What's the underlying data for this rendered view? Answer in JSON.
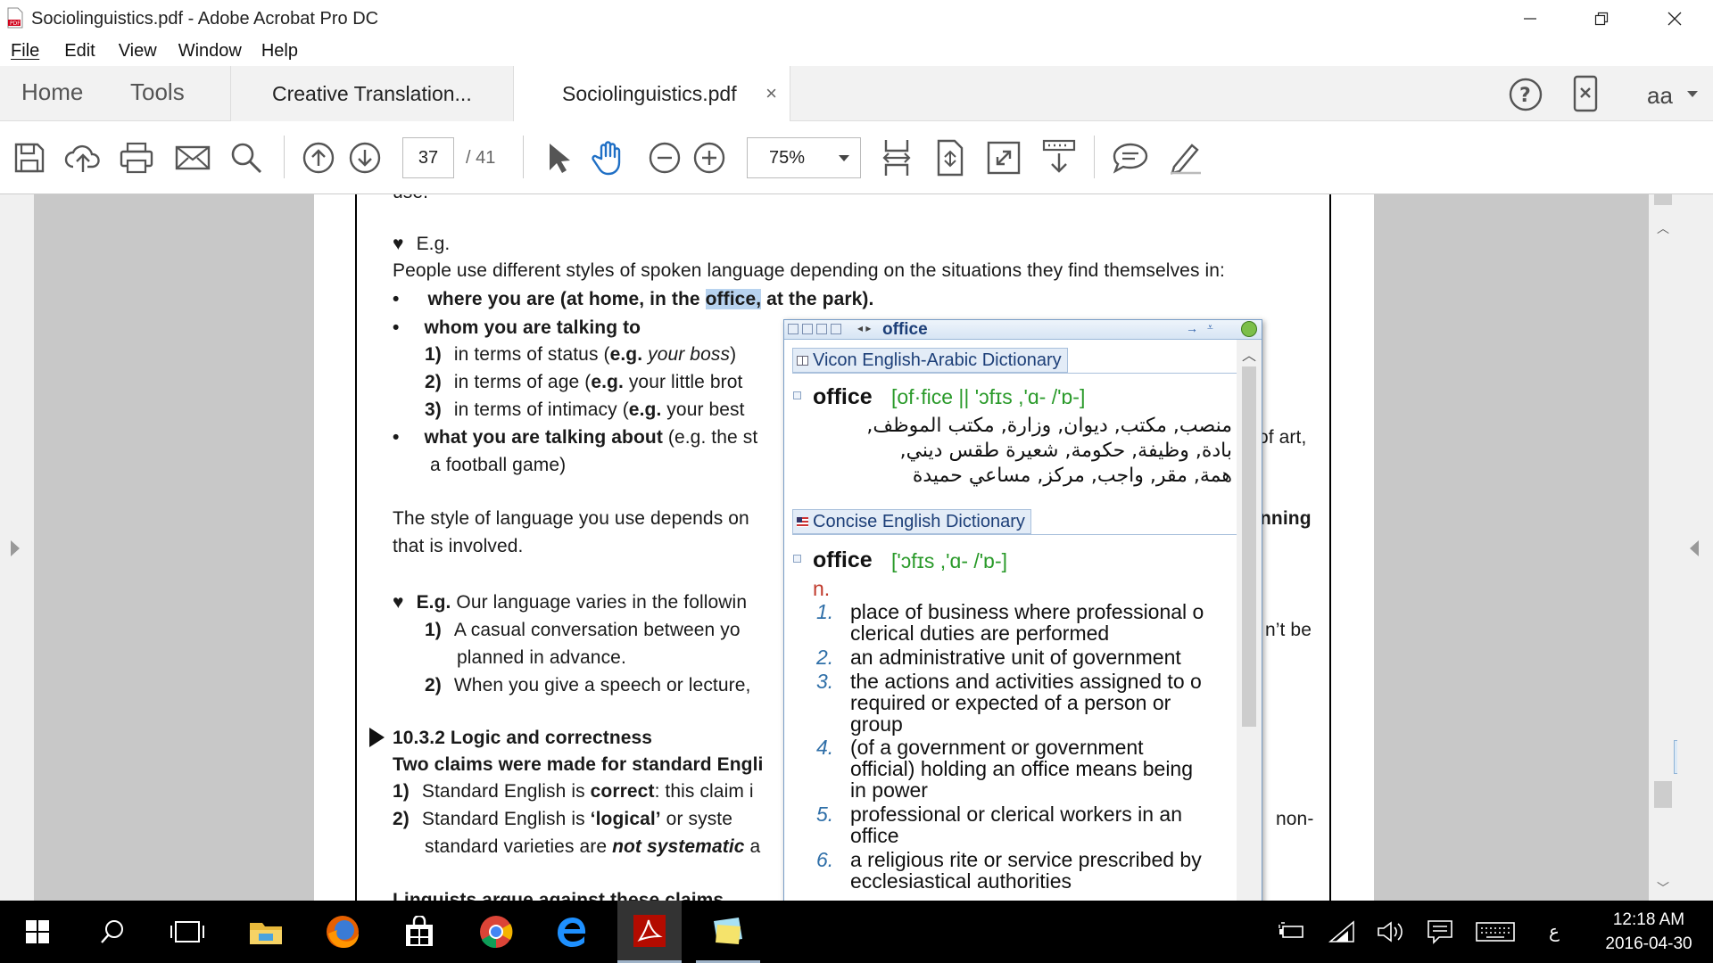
{
  "window": {
    "title": "Sociolinguistics.pdf - Adobe Acrobat Pro DC",
    "app_icon": "acrobat-pdf-icon",
    "controls": [
      "minimize-icon",
      "restore-icon",
      "close-icon"
    ]
  },
  "menu": [
    "File",
    "Edit",
    "View",
    "Window",
    "Help"
  ],
  "tabs": {
    "home": "Home",
    "tools": "Tools",
    "documents": [
      {
        "label": "Creative Translation...",
        "active": false
      },
      {
        "label": "Sociolinguistics.pdf",
        "active": true,
        "close": "×"
      }
    ],
    "right": {
      "help": "?",
      "font_size": "aa"
    }
  },
  "toolbar": {
    "page_current": "37",
    "page_total": "/  41",
    "zoom": "75%",
    "icons": [
      "save-icon",
      "cloud-upload-icon",
      "print-icon",
      "email-icon",
      "search-icon",
      "page-up-icon",
      "page-down-icon",
      "select-arrow-icon",
      "hand-tool-icon",
      "zoom-out-icon",
      "zoom-in-icon",
      "fit-page-icon",
      "scroll-mode-icon",
      "full-screen-icon",
      "read-mode-icon",
      "comment-icon",
      "sign-pen-icon"
    ]
  },
  "document": {
    "cutoff_top": "use.",
    "eg1_label": "E.g.",
    "intro": "People use different styles of spoken language  depending on the situations they find themselves in:",
    "bullet1_pre": "where you are (at home, in the ",
    "bullet1_hl": "office,",
    "bullet1_post": " at the park).",
    "bullet2": "whom you are talking to",
    "sub1_num": "1)",
    "sub1_pre": "in terms of status (",
    "sub1_eg": "e.g.",
    "sub1_it": " your boss",
    "sub1_post": ")",
    "sub2_num": "2)",
    "sub2_pre": "in terms of age (",
    "sub2_eg": "e.g.",
    "sub2_post": " your little brot",
    "sub3_num": "3)",
    "sub3_pre": "in terms of intimacy (",
    "sub3_eg": "e.g.",
    "sub3_post": " your best",
    "bullet3_b": "what you are talking about",
    "bullet3_post": " (e.g. the st",
    "bullet3_right": "of art,",
    "bullet3_cont": "a football game)",
    "style_pre": "The style of language you use depends on",
    "style_right": "nning",
    "style_cont": "that is involved.",
    "eg2_label": "E.g.",
    "eg2_text": " Our language varies in the followin",
    "eg2_1_num": "1)",
    "eg2_1_text": "A  casual  conversation  between  yo",
    "eg2_1_right": "n’t  be",
    "eg2_1_cont": "planned in advance.",
    "eg2_2_num": "2)",
    "eg2_2_text": "When you give a speech or lecture,",
    "section_title": "10.3.2 Logic and correctness",
    "claims": "Two claims were made for standard Engli",
    "claim1_num": "1)",
    "claim1_pre": "Standard English is ",
    "claim1_b": "correct",
    "claim1_post": ": this claim i",
    "claim2_num": "2)",
    "claim2_pre": "Standard  English  is  ",
    "claim2_b": "‘logical’",
    "claim2_post": "  or  syste",
    "claim2_right": "non-",
    "claim2_cont_pre": "standard varieties are ",
    "claim2_cont_bi": "not systematic",
    "claim2_cont_post": " a",
    "cutoff_bottom": "Linguists argue against these claims"
  },
  "dictionary_popup": {
    "lookup_word": "office",
    "sections": [
      {
        "name": "Vicon English-Arabic Dictionary",
        "headword": "office",
        "pronunciation": "[of·fice || 'ɔfɪs ,'ɑ- /'ɒ-]",
        "arabic_lines": [
          "منصب, مكتب, ديوان, وزارة, مكتب الموظف,",
          "بادة, وظيفة, حكومة, شعيرة طقس ديني,",
          "همة, مقر, واجب, مركز, مساعي حميدة"
        ]
      },
      {
        "name": "Concise English Dictionary",
        "headword": "office",
        "pronunciation": "['ɔfɪs ,'ɑ- /'ɒ-]",
        "part_of_speech": "n.",
        "senses": [
          {
            "num": "1.",
            "lines": [
              "place of business where professional o",
              "clerical duties are performed"
            ]
          },
          {
            "num": "2.",
            "lines": [
              "an administrative unit of government"
            ]
          },
          {
            "num": "3.",
            "lines": [
              "the actions and activities assigned to o",
              "required or expected of a person or",
              "group"
            ]
          },
          {
            "num": "4.",
            "lines": [
              "(of a government or government",
              "official) holding an office means being",
              "in power"
            ]
          },
          {
            "num": "5.",
            "lines": [
              "professional or clerical workers in an",
              "office"
            ]
          },
          {
            "num": "6.",
            "lines": [
              "a religious rite or service prescribed by",
              "ecclesiastical authorities"
            ]
          }
        ]
      }
    ]
  },
  "taskbar": {
    "apps": [
      "windows-start-icon",
      "search-icon",
      "task-view-icon",
      "file-explorer-icon",
      "firefox-icon",
      "store-icon",
      "chrome-icon",
      "edge-icon",
      "acrobat-icon",
      "sticky-notes-icon"
    ],
    "tray_icons": [
      "battery-icon",
      "wifi-icon",
      "volume-icon",
      "notifications-icon",
      "keyboard-icon"
    ],
    "language": "ع",
    "time": "12:18 AM",
    "date": "2016-04-30"
  }
}
